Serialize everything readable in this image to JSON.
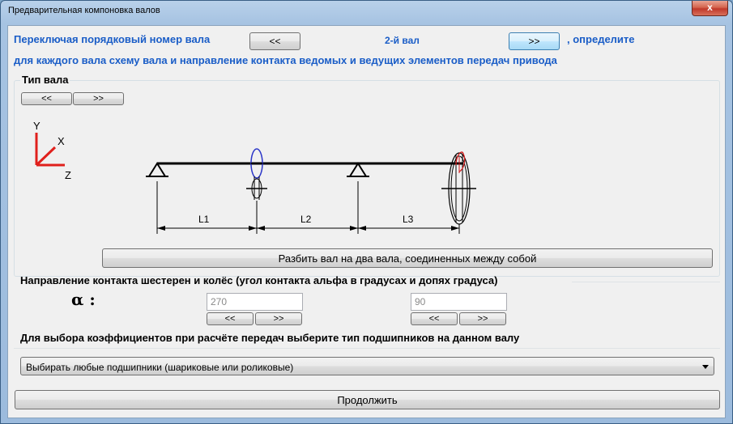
{
  "window": {
    "title": "Предварительная компоновка валов",
    "close_label": "x"
  },
  "shaft_nav": {
    "intro": "Переключая порядковый номер вала",
    "prev_label": "<<",
    "current": "2-й вал",
    "next_label": ">>",
    "after": ", определите",
    "line2": "для каждого вала схему вала и направление контакта ведомых и ведущих элементов передач привода"
  },
  "shaft_type": {
    "legend": "Тип вала",
    "prev_label": "<<",
    "next_label": ">>",
    "axes": {
      "y": "Y",
      "x": "X",
      "z": "Z"
    },
    "dims": {
      "l1": "L1",
      "l2": "L2",
      "l3": "L3"
    },
    "split_label": "Разбить вал на два вала, соединенных между собой"
  },
  "contact": {
    "title": "Направление контакта шестерен и колёс (угол контакта альфа в градусах и допях градуса)",
    "alpha_label": "α :",
    "angle1": {
      "value": "270",
      "prev_label": "<<",
      "next_label": ">>"
    },
    "angle2": {
      "value": "90",
      "prev_label": "<<",
      "next_label": ">>"
    }
  },
  "bearings": {
    "title": "Для выбора коэффициентов при расчёте передач выберите тип подшипников на данном валу",
    "selected": "Выбирать любые подшипники (шариковые или роликовые)"
  },
  "continue_label": "Продолжить",
  "colors": {
    "heading_blue": "#1a5dc7",
    "axis_red": "#e0201c",
    "gear_blue": "#2a35c8",
    "gear_red": "#d01818"
  }
}
